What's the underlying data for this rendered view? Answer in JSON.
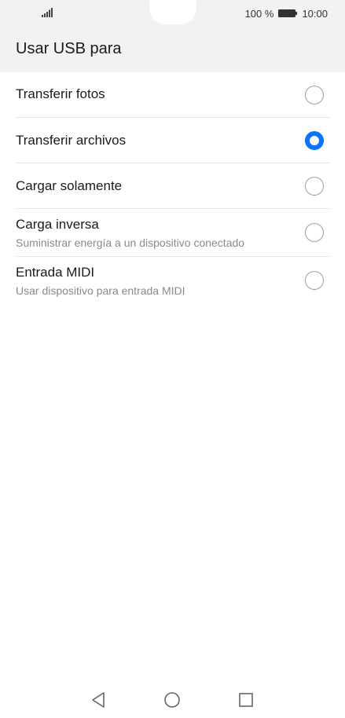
{
  "status_bar": {
    "battery_percent": "100 %",
    "time": "10:00",
    "signal_icon": "signal-icon",
    "battery_icon": "battery-icon"
  },
  "page": {
    "title": "Usar USB para"
  },
  "options": [
    {
      "title": "Transferir fotos",
      "subtitle": "",
      "checked": false
    },
    {
      "title": "Transferir archivos",
      "subtitle": "",
      "checked": true
    },
    {
      "title": "Cargar solamente",
      "subtitle": "",
      "checked": false
    },
    {
      "title": "Carga inversa",
      "subtitle": "Suministrar energía a un dispositivo conectado",
      "checked": false
    },
    {
      "title": "Entrada MIDI",
      "subtitle": "Usar dispositivo para entrada MIDI",
      "checked": false
    }
  ],
  "nav_bar": {
    "back_icon": "back-icon",
    "home_icon": "home-icon",
    "recents_icon": "recents-icon"
  },
  "colors": {
    "accent": "#0a74ff",
    "header_bg": "#f2f2f2"
  }
}
